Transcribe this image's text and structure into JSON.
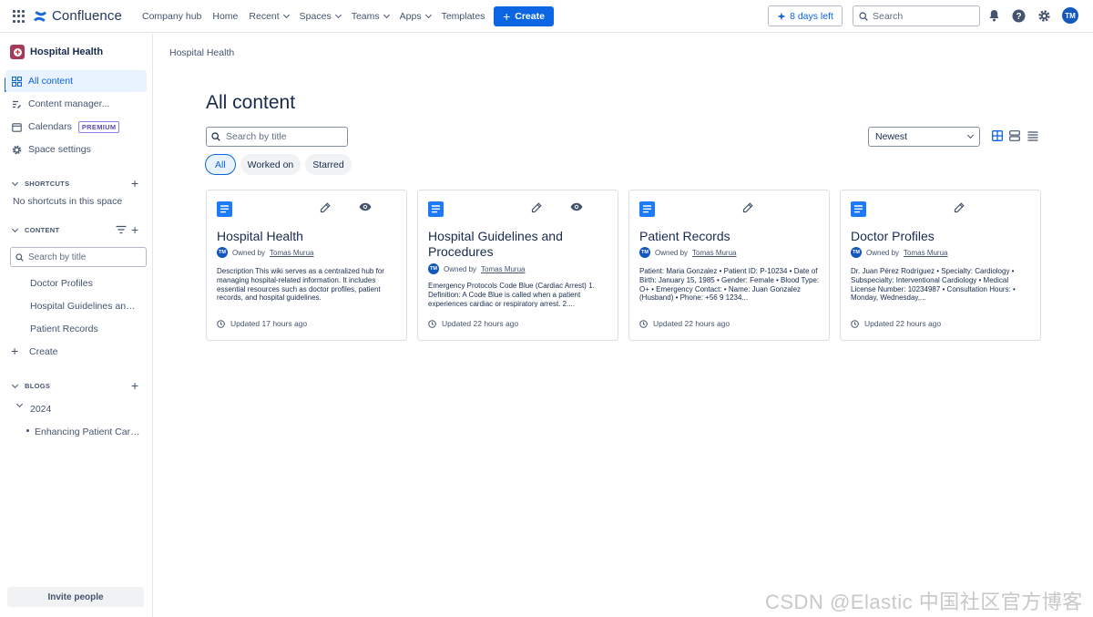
{
  "topbar": {
    "product": "Confluence",
    "nav": [
      {
        "label": "Company hub",
        "dropdown": false
      },
      {
        "label": "Home",
        "dropdown": false
      },
      {
        "label": "Recent",
        "dropdown": true
      },
      {
        "label": "Spaces",
        "dropdown": true
      },
      {
        "label": "Teams",
        "dropdown": true
      },
      {
        "label": "Apps",
        "dropdown": true
      },
      {
        "label": "Templates",
        "dropdown": false
      }
    ],
    "create_label": "Create",
    "trial_label": "8 days left",
    "search_placeholder": "Search",
    "user_initials": "TM"
  },
  "sidebar": {
    "space_name": "Hospital Health",
    "items": [
      {
        "label": "All content",
        "icon": "grid-icon",
        "active": true
      },
      {
        "label": "Content manager...",
        "icon": "content-manager-icon"
      },
      {
        "label": "Calendars",
        "icon": "calendar-icon",
        "badge": "PREMIUM"
      },
      {
        "label": "Space settings",
        "icon": "gear-icon"
      }
    ],
    "shortcuts_heading": "SHORTCUTS",
    "shortcuts_empty": "No shortcuts in this space",
    "content_heading": "CONTENT",
    "content_search_placeholder": "Search by title",
    "content_tree": [
      "Doctor Profiles",
      "Hospital Guidelines and Procedures",
      "Patient Records"
    ],
    "create_label": "Create",
    "blogs_heading": "BLOGS",
    "blog_year": "2024",
    "blog_posts": [
      "Enhancing Patient Care Through Technology"
    ],
    "invite_label": "Invite people"
  },
  "main": {
    "breadcrumb": "Hospital Health",
    "title": "All content",
    "search_placeholder": "Search by title",
    "filters": [
      "All",
      "Worked on",
      "Starred"
    ],
    "sort_value": "Newest",
    "cards": [
      {
        "title": "Hospital Health",
        "owner_prefix": "Owned by",
        "owner": "Tomas Murua",
        "excerpt": "Description This wiki serves as a centralized hub for managing hospital-related information. It includes essential resources such as doctor profiles, patient records, and hospital guidelines.",
        "updated": "Updated 17 hours ago",
        "watch": true
      },
      {
        "title": "Hospital Guidelines and Procedures",
        "owner_prefix": "Owned by",
        "owner": "Tomas Murua",
        "excerpt": "Emergency Protocols Code Blue (Cardiac Arrest) 1. Definition: A Code Blue is called when a patient experiences cardiac or respiratory arrest. 2....",
        "updated": "Updated 22 hours ago",
        "watch": true
      },
      {
        "title": "Patient Records",
        "owner_prefix": "Owned by",
        "owner": "Tomas Murua",
        "excerpt": "Patient: Maria Gonzalez • Patient ID: P-10234 • Date of Birth: January 15, 1985 • Gender: Female • Blood Type: O+ • Emergency Contact: • Name: Juan Gonzalez (Husband) • Phone: +56 9 1234...",
        "updated": "Updated 22 hours ago",
        "watch": false
      },
      {
        "title": "Doctor Profiles",
        "owner_prefix": "Owned by",
        "owner": "Tomas Murua",
        "excerpt": "Dr. Juan Pérez Rodríguez • Specialty: Cardiology • Subspecialty: Interventional Cardiology • Medical License Number: 10234987 • Consultation Hours: • Monday, Wednesday,...",
        "updated": "Updated 22 hours ago",
        "watch": false
      }
    ]
  },
  "watermark": "CSDN @Elastic 中国社区官方博客",
  "colors": {
    "accent": "#0c66e4",
    "text": "#172b4d",
    "muted": "#44546f",
    "page_icon": "#1d7afc"
  }
}
